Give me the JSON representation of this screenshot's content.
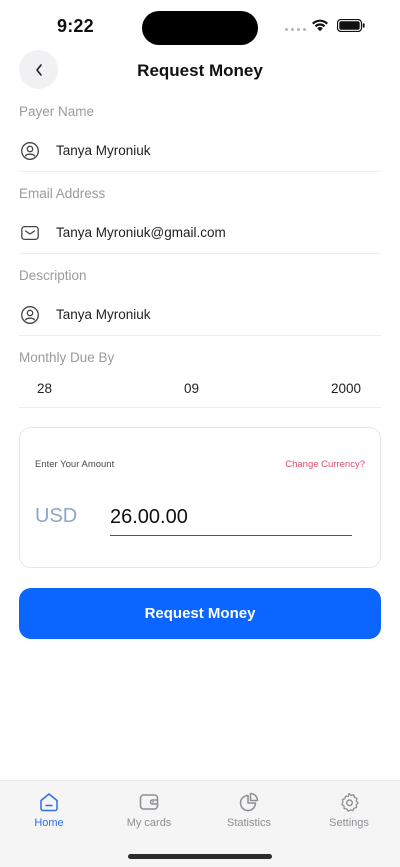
{
  "status_bar": {
    "time": "9:22"
  },
  "header": {
    "title": "Request Money"
  },
  "fields": {
    "payer": {
      "label": "Payer Name",
      "value": "Tanya Myroniuk"
    },
    "email": {
      "label": "Email Address",
      "value": "Tanya Myroniuk@gmail.com"
    },
    "description": {
      "label": "Description",
      "value": "Tanya Myroniuk"
    },
    "due": {
      "label": "Monthly Due By",
      "day": "28",
      "month": "09",
      "year": "2000"
    }
  },
  "amount": {
    "label": "Enter Your Amount",
    "change_currency": "Change Currency?",
    "currency": "USD",
    "value": "26.00.00"
  },
  "request_button": "Request Money",
  "tabs": [
    {
      "label": "Home",
      "icon": "home-icon",
      "active": true
    },
    {
      "label": "My cards",
      "icon": "wallet-icon",
      "active": false
    },
    {
      "label": "Statistics",
      "icon": "pie-chart-icon",
      "active": false
    },
    {
      "label": "Settings",
      "icon": "gear-icon",
      "active": false
    }
  ],
  "colors": {
    "primary": "#0a66ff",
    "accent_link": "#e14a6a",
    "active_tab": "#2f6fe6"
  }
}
